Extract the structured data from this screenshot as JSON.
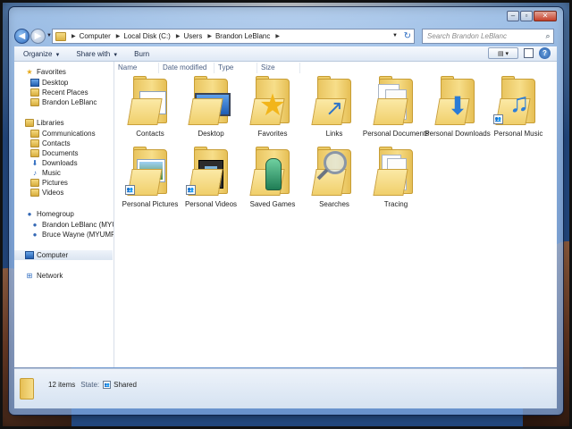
{
  "window": {
    "caption_buttons": [
      "minimize",
      "maximize",
      "close"
    ]
  },
  "address": {
    "breadcrumbs": [
      "Computer",
      "Local Disk (C:)",
      "Users",
      "Brandon LeBlanc"
    ]
  },
  "search": {
    "placeholder": "Search Brandon LeBlanc"
  },
  "toolbar": {
    "organize": "Organize",
    "share_with": "Share with",
    "burn": "Burn"
  },
  "columns": [
    "Name",
    "Date modified",
    "Type",
    "Size"
  ],
  "nav": {
    "favorites": "Favorites",
    "favorites_items": [
      "Desktop",
      "Recent Places",
      "Brandon LeBlanc"
    ],
    "libraries": "Libraries",
    "libraries_items": [
      "Communications",
      "Contacts",
      "Documents",
      "Downloads",
      "Music",
      "Pictures",
      "Videos"
    ],
    "homegroup": "Homegroup",
    "homegroup_items": [
      "Brandon LeBlanc (MYUM",
      "Bruce Wayne (MYUMPC)"
    ],
    "computer": "Computer",
    "network": "Network"
  },
  "items": [
    {
      "label": "Contacts",
      "icon": "contacts-card",
      "shared": false
    },
    {
      "label": "Desktop",
      "icon": "monitor",
      "shared": false
    },
    {
      "label": "Favorites",
      "icon": "star",
      "shared": false
    },
    {
      "label": "Links",
      "icon": "link-arrow",
      "shared": false
    },
    {
      "label": "Personal Documents",
      "icon": "documents",
      "shared": false
    },
    {
      "label": "Personal Downloads",
      "icon": "download-arrow",
      "shared": false
    },
    {
      "label": "Personal Music",
      "icon": "music-note",
      "shared": true
    },
    {
      "label": "Personal Pictures",
      "icon": "picture",
      "shared": true
    },
    {
      "label": "Personal Videos",
      "icon": "film",
      "shared": true
    },
    {
      "label": "Saved Games",
      "icon": "trophy",
      "shared": false
    },
    {
      "label": "Searches",
      "icon": "magnifier",
      "shared": false
    },
    {
      "label": "Tracing",
      "icon": "pages",
      "shared": false
    }
  ],
  "details": {
    "count": "12 items",
    "state_label": "State:",
    "state_value": "Shared"
  },
  "colors": {
    "folder": "#f0cf6b",
    "accent": "#2f6cc0"
  }
}
